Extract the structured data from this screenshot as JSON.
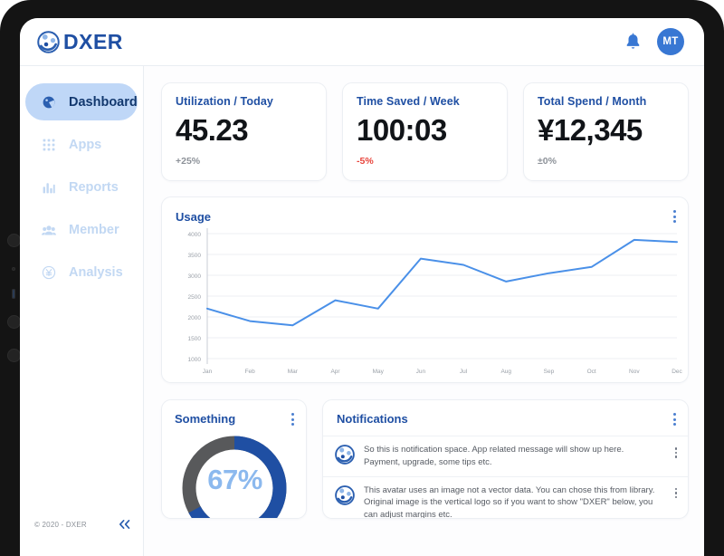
{
  "header": {
    "brand": "DXER",
    "brand_color": "#1f4fa3",
    "bell_icon": "bell-icon",
    "avatar_initials": "MT",
    "avatar_color": "#3877d3"
  },
  "sidebar": {
    "items": [
      {
        "label": "Dashboard",
        "icon": "dashboard-icon",
        "active": true
      },
      {
        "label": "Apps",
        "icon": "grid-icon",
        "active": false
      },
      {
        "label": "Reports",
        "icon": "bar-chart-icon",
        "active": false
      },
      {
        "label": "Member",
        "icon": "people-icon",
        "active": false
      },
      {
        "label": "Analysis",
        "icon": "yen-circle-icon",
        "active": false
      }
    ],
    "copyright": "© 2020 - DXER",
    "collapse_icon": "chevron-double-left-icon",
    "active_bg": "#bfd7f7",
    "active_text": "#12386e",
    "inactive_text": "#c2d8f3"
  },
  "stats": [
    {
      "label": "Utilization / Today",
      "value": "45.23",
      "delta": "+25%",
      "delta_tone": "neutral"
    },
    {
      "label": "Time Saved / Week",
      "value": "100:03",
      "delta": "-5%",
      "delta_tone": "negative"
    },
    {
      "label": "Total Spend / Month",
      "value": "¥12,345",
      "delta": "±0%",
      "delta_tone": "neutral"
    }
  ],
  "usage": {
    "title": "Usage",
    "menu_icon": "kebab-menu-icon"
  },
  "chart_data": {
    "type": "line",
    "title": "Usage",
    "xlabel": "",
    "ylabel": "",
    "categories": [
      "Jan",
      "Feb",
      "Mar",
      "Apr",
      "May",
      "Jun",
      "Jul",
      "Aug",
      "Sep",
      "Oct",
      "Nov",
      "Dec"
    ],
    "values": [
      2200,
      1900,
      1800,
      2400,
      2200,
      3400,
      3250,
      2850,
      3050,
      3200,
      3850,
      3800
    ],
    "ylim": [
      1000,
      4000
    ],
    "yticks": [
      1000,
      1500,
      2000,
      2500,
      3000,
      3500,
      4000
    ],
    "grid": true,
    "legend": "none",
    "line_color": "#4a90e8"
  },
  "something": {
    "title": "Something",
    "menu_icon": "kebab-menu-icon",
    "percent_label": "67%",
    "percent_value": 67,
    "arc_color": "#1f4fa3",
    "track_color": "#58595b",
    "label_color": "#8cb9ee"
  },
  "notifications": {
    "title": "Notifications",
    "menu_icon": "kebab-menu-icon",
    "items": [
      {
        "avatar_icon": "dxer-logo-avatar-icon",
        "text": "So this is notification space. App related message will show up here. Payment, upgrade, some tips etc.",
        "menu_icon": "kebab-menu-icon"
      },
      {
        "avatar_icon": "dxer-logo-avatar-icon",
        "text": "This avatar uses an image not a vector data. You can chose this from library. Original image is the vertical logo so if you want to show \"DXER\" below, you can adjust margins etc.",
        "menu_icon": "kebab-menu-icon"
      }
    ]
  }
}
